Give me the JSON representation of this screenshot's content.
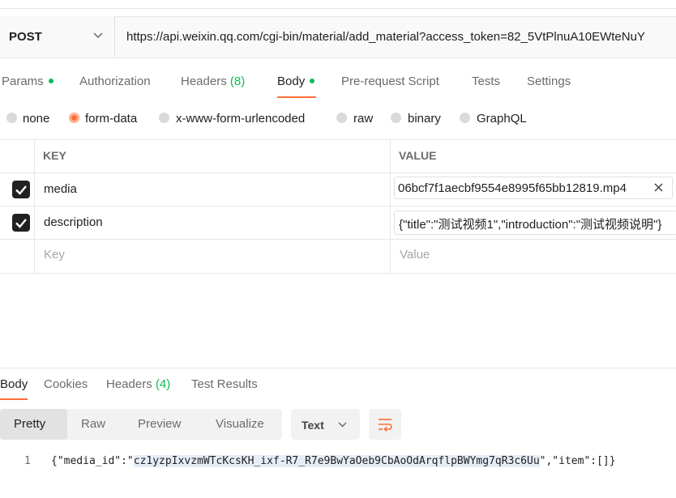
{
  "request": {
    "method": "POST",
    "url": "https://api.weixin.qq.com/cgi-bin/material/add_material?access_token=82_5VtPlnuA10EWteNuY"
  },
  "req_tabs": [
    {
      "label": "Params"
    },
    {
      "label": "Authorization"
    },
    {
      "label": "Headers",
      "count": "(8)"
    },
    {
      "label": "Body"
    },
    {
      "label": "Pre-request Script"
    },
    {
      "label": "Tests"
    },
    {
      "label": "Settings"
    }
  ],
  "body_types": [
    "none",
    "form-data",
    "x-www-form-urlencoded",
    "raw",
    "binary",
    "GraphQL"
  ],
  "body_type_selected": "form-data",
  "table": {
    "headers": {
      "key": "KEY",
      "value": "VALUE"
    },
    "rows": [
      {
        "key": "media",
        "value": "06bcf7f1aecbf9554e8995f65bb12819.mp4",
        "checked": true
      },
      {
        "key": "description",
        "value": "{\"title\":\"测试视频1\",\"introduction\":\"测试视频说明\"}",
        "checked": true
      }
    ],
    "placeholder": {
      "key": "Key",
      "value": "Value"
    }
  },
  "resp_tabs": [
    {
      "label": "Body"
    },
    {
      "label": "Cookies"
    },
    {
      "label": "Headers",
      "count": "(4)"
    },
    {
      "label": "Test Results"
    }
  ],
  "view_modes": [
    "Pretty",
    "Raw",
    "Preview",
    "Visualize"
  ],
  "view_mode_selected": "Pretty",
  "format": "Text",
  "response": {
    "line_number": "1",
    "prefix": "{\"media_id\":\"",
    "media_id": "cz1yzpIxvzmWTcKcsKH_ixf-R7_R7e9BwYaOeb9CbAoOdArqflpBWYmg7qR3c6Uu",
    "suffix": "\",\"item\":[]}"
  },
  "colors": {
    "accent": "#ff6c37",
    "success": "#0cbb52"
  }
}
